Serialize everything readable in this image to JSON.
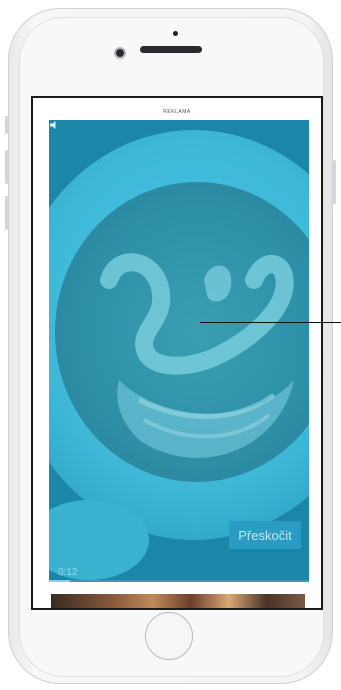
{
  "ad": {
    "label": "REKLAMA",
    "timer": "0:12",
    "progress_fraction": 0.08,
    "skip_label": "Přeskočit"
  },
  "icons": {
    "mute": "speaker-icon"
  },
  "colors": {
    "video_tint": "#1d8fb0",
    "skip_bg": "#2a9cc3",
    "skip_text": "#bfe9f5"
  }
}
